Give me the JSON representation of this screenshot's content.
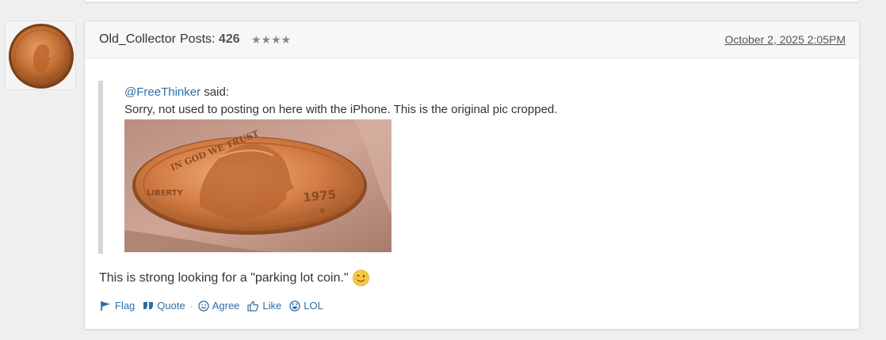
{
  "post": {
    "username": "Old_Collector",
    "posts_label": "Posts:",
    "posts_count": "426",
    "stars": "★★★★",
    "date": "October 2, 2025 2:05PM",
    "quote": {
      "user": "@FreeThinker",
      "said": "said:",
      "text": "Sorry, not used to posting on here with the iPhone. This is the original pic cropped.",
      "coin_words": {
        "motto": "IN GOD WE TRUST",
        "liberty": "LIBERTY",
        "year": "1975",
        "mint": "D"
      }
    },
    "message": "This is strong looking for a \"parking lot coin.\"",
    "emoji_icon": "winking-face-icon",
    "actions": [
      {
        "label": "Flag",
        "icon": "flag-icon"
      },
      {
        "label": "Quote",
        "icon": "quote-icon"
      },
      {
        "label": "Agree",
        "icon": "smile-icon"
      },
      {
        "label": "Like",
        "icon": "thumbs-up-icon"
      },
      {
        "label": "LOL",
        "icon": "laugh-icon"
      }
    ]
  },
  "colors": {
    "link": "#2b6ea8",
    "header_bg": "#f7f7f7",
    "page_bg": "#efefef",
    "copper": "#c8763a"
  }
}
